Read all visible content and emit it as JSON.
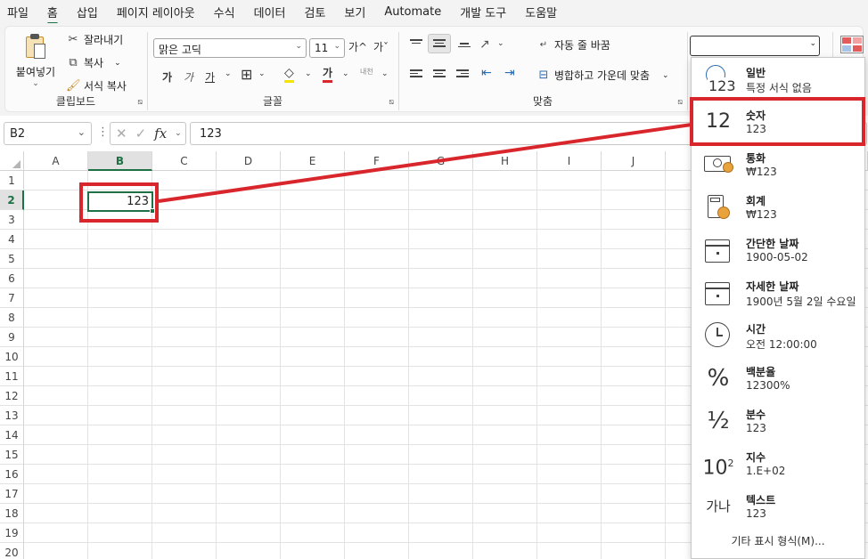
{
  "menu": [
    "파일",
    "홈",
    "삽입",
    "페이지 레이아웃",
    "수식",
    "데이터",
    "검토",
    "보기",
    "Automate",
    "개발 도구",
    "도움말"
  ],
  "ribbon": {
    "clipboard": {
      "paste_label": "붙여넣기",
      "cut_label": "잘라내기",
      "copy_label": "복사",
      "format_painter_label": "서식 복사",
      "group_label": "클립보드"
    },
    "font": {
      "font_name": "맑은 고딕",
      "font_size": "11",
      "grow_font": "가^",
      "shrink_font": "가ˇ",
      "bold": "가",
      "italic": "가",
      "underline": "가",
      "font_color_glyph": "가",
      "phonetic": "내천",
      "group_label": "글꼴"
    },
    "alignment": {
      "wrap_text_label": "자동 줄 바꿈",
      "merge_center_label": "병합하고 가운데 맞춤",
      "group_label": "맞춤"
    },
    "number_format_value": ""
  },
  "formula_bar": {
    "name_box": "B2",
    "fx_label": "fx",
    "formula": "123"
  },
  "grid": {
    "columns": [
      "A",
      "B",
      "C",
      "D",
      "E",
      "F",
      "G",
      "H",
      "I",
      "J"
    ],
    "rows": [
      "1",
      "2",
      "3",
      "4",
      "5",
      "6",
      "7",
      "8",
      "9",
      "10",
      "11",
      "12",
      "13",
      "14",
      "15",
      "16",
      "17",
      "18",
      "19",
      "20"
    ],
    "active_cell_value": "123"
  },
  "number_formats": [
    {
      "name": "일반",
      "sample": "특정 서식 없음",
      "icon": "clock-123-icon"
    },
    {
      "name": "숫자",
      "sample": "123",
      "icon": "number-12-icon"
    },
    {
      "name": "통화",
      "sample": "₩123",
      "icon": "currency-icon"
    },
    {
      "name": "회계",
      "sample": " ₩123",
      "icon": "accounting-calculator-icon"
    },
    {
      "name": "간단한 날짜",
      "sample": "1900-05-02",
      "icon": "calendar-icon"
    },
    {
      "name": "자세한 날짜",
      "sample": "1900년 5월 2일 수요일",
      "icon": "calendar-icon"
    },
    {
      "name": "시간",
      "sample": "오전 12:00:00",
      "icon": "clock-icon"
    },
    {
      "name": "백분율",
      "sample": "12300%",
      "icon": "percent-icon"
    },
    {
      "name": "분수",
      "sample": "123",
      "icon": "fraction-icon"
    },
    {
      "name": "지수",
      "sample": "1.E+02",
      "icon": "scientific-icon"
    },
    {
      "name": "텍스트",
      "sample": "123",
      "icon": "text-icon"
    }
  ],
  "number_format_glyphs": {
    "general": "123",
    "number": "12",
    "percent": "%",
    "fraction": "½",
    "scientific_base": "10",
    "scientific_exp": "2",
    "text": "가나"
  },
  "more_formats_label": "기타 표시 형식(M)...",
  "colors": {
    "excel_green": "#1e7145",
    "highlight_red": "#d9262c"
  }
}
